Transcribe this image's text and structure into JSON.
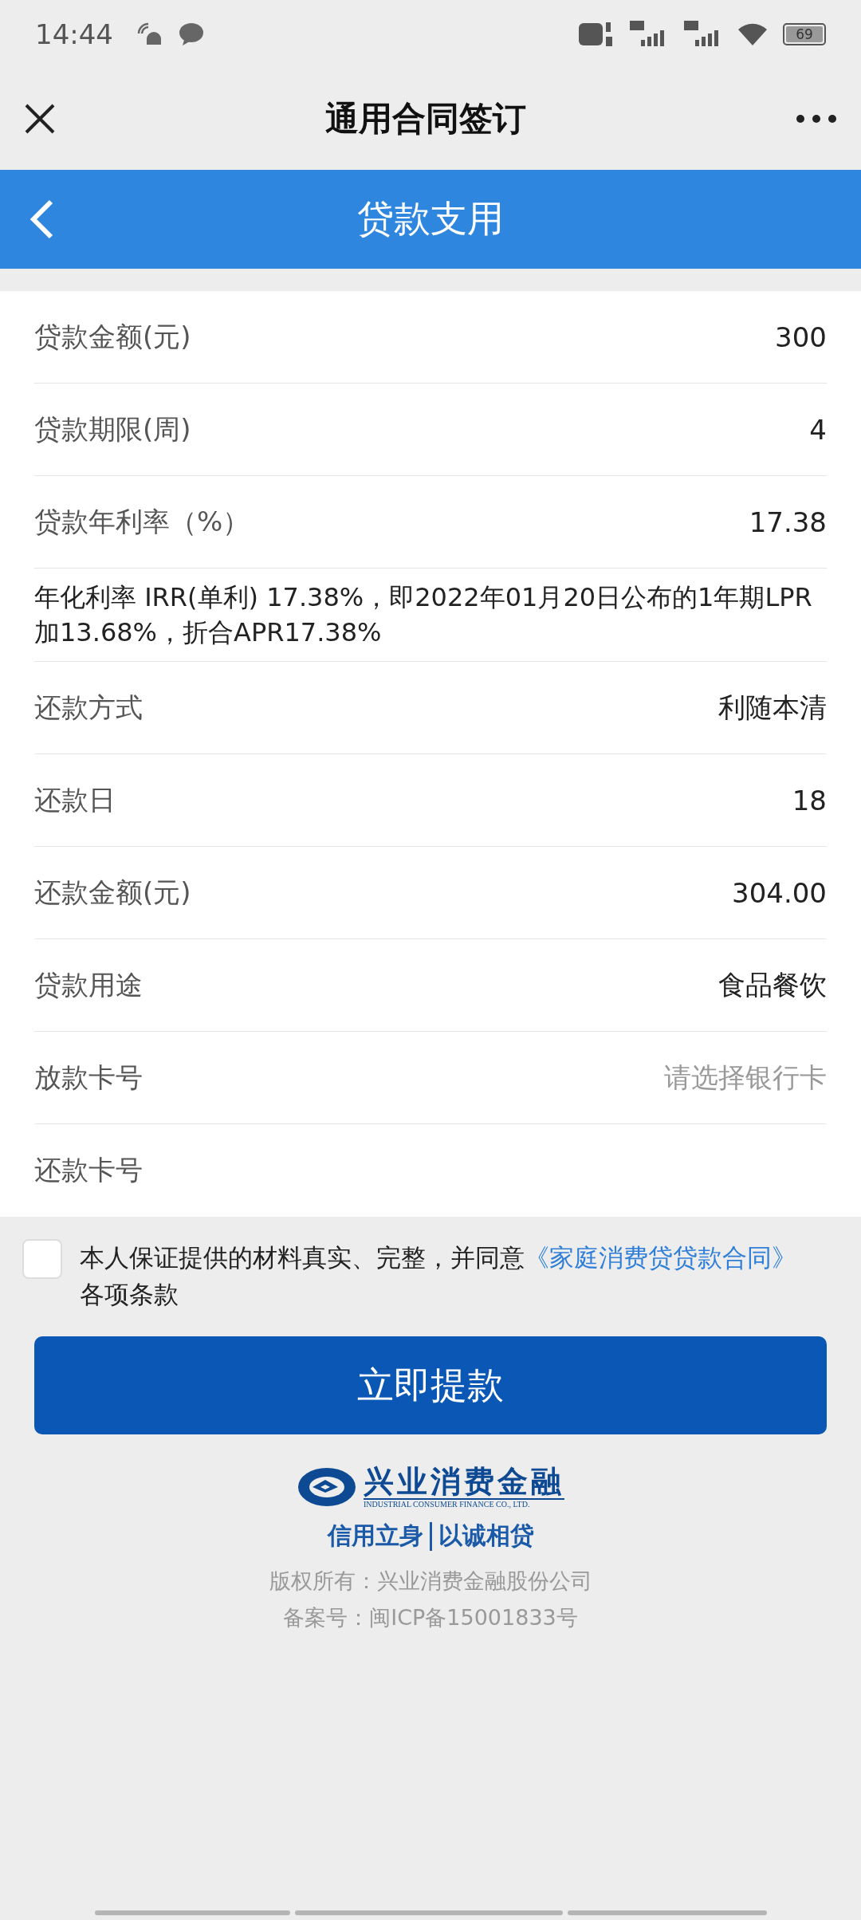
{
  "status_bar": {
    "time": "14:44",
    "battery": "69"
  },
  "header": {
    "title": "通用合同签订"
  },
  "nav_bar": {
    "title": "贷款支用"
  },
  "rows": [
    {
      "kind": "field",
      "label": "贷款金额(元)",
      "value": "300"
    },
    {
      "kind": "field",
      "label": "贷款期限(周)",
      "value": "4"
    },
    {
      "kind": "field",
      "label": "贷款年利率（%）",
      "value": "17.38"
    },
    {
      "kind": "note",
      "text": "年化利率 IRR(单利) 17.38%，即2022年01月20日公布的1年期LPR加13.68%，折合APR17.38%"
    },
    {
      "kind": "field",
      "label": "还款方式",
      "value": "利随本清"
    },
    {
      "kind": "field",
      "label": "还款日",
      "value": "18"
    },
    {
      "kind": "field",
      "label": "还款金额(元)",
      "value": "304.00"
    },
    {
      "kind": "field",
      "label": "贷款用途",
      "value": "食品餐饮"
    },
    {
      "kind": "field",
      "label": "放款卡号",
      "placeholder": "请选择银行卡"
    },
    {
      "kind": "field",
      "label": "还款卡号"
    }
  ],
  "agreement": {
    "checked": false,
    "text": "本人保证提供的材料真实、完整，并同意",
    "link": "《家庭消费贷贷款合同》",
    "suffix": "各项条款"
  },
  "submit_button": "立即提款",
  "footer": {
    "brand": "兴业消费金融",
    "brand_en": "INDUSTRIAL CONSUMER FINANCE CO., LTD.",
    "slogan_left": "信用立身",
    "slogan_right": "以诚相贷",
    "copyright": "版权所有：兴业消费金融股份公司",
    "icp": "备案号：闽ICP备15001833号"
  }
}
